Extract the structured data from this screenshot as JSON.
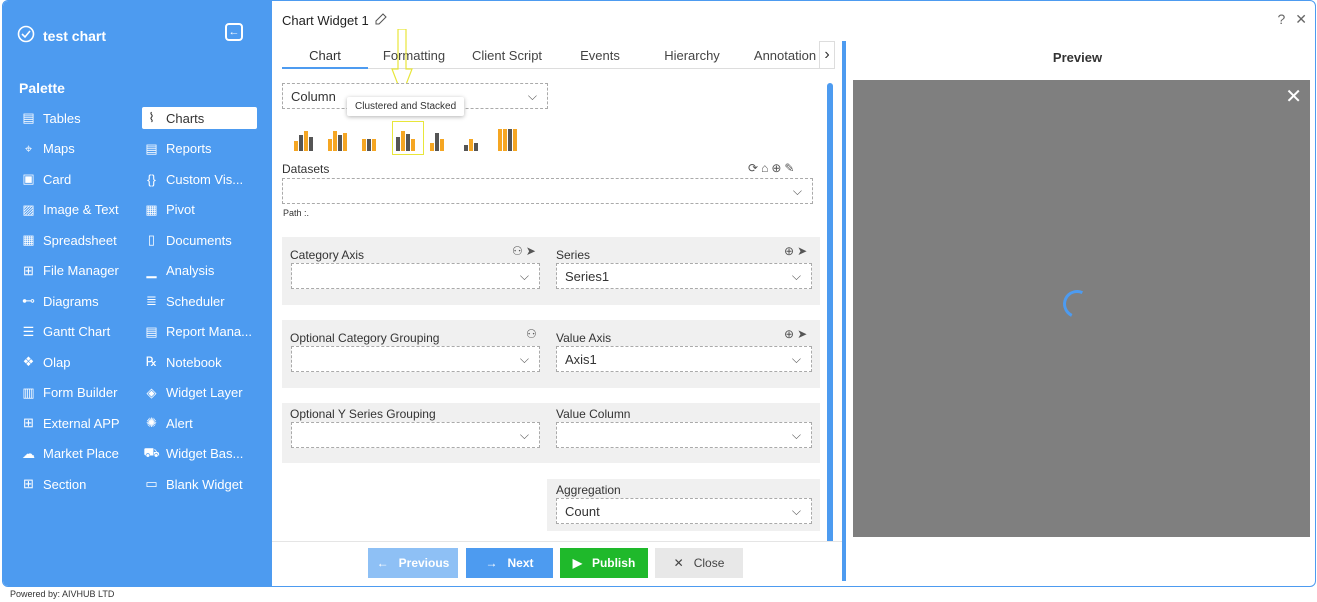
{
  "app": {
    "title": "test chart"
  },
  "palette": {
    "title": "Palette",
    "left": [
      {
        "label": "Tables",
        "icon": "table-icon"
      },
      {
        "label": "Maps",
        "icon": "map-icon"
      },
      {
        "label": "Card",
        "icon": "card-icon"
      },
      {
        "label": "Image & Text",
        "icon": "image-icon"
      },
      {
        "label": "Spreadsheet",
        "icon": "spreadsheet-icon"
      },
      {
        "label": "File Manager",
        "icon": "folder-tree-icon"
      },
      {
        "label": "Diagrams",
        "icon": "diagram-icon"
      },
      {
        "label": "Gantt Chart",
        "icon": "gantt-icon"
      },
      {
        "label": "Olap",
        "icon": "cubes-icon"
      },
      {
        "label": "Form Builder",
        "icon": "form-icon"
      },
      {
        "label": "External APP",
        "icon": "apps-icon"
      },
      {
        "label": "Market Place",
        "icon": "cloud-upload-icon"
      },
      {
        "label": "Section",
        "icon": "section-grid-icon"
      }
    ],
    "right": [
      {
        "label": "Charts",
        "icon": "line-chart-icon"
      },
      {
        "label": "Reports",
        "icon": "report-icon"
      },
      {
        "label": "Custom Vis...",
        "icon": "braces-icon"
      },
      {
        "label": "Pivot",
        "icon": "pivot-icon"
      },
      {
        "label": "Documents",
        "icon": "document-icon"
      },
      {
        "label": "Analysis",
        "icon": "analysis-icon"
      },
      {
        "label": "Scheduler",
        "icon": "scheduler-icon"
      },
      {
        "label": "Report Mana...",
        "icon": "report-manager-icon"
      },
      {
        "label": "Notebook",
        "icon": "notebook-icon"
      },
      {
        "label": "Widget Layer",
        "icon": "layers-icon"
      },
      {
        "label": "Alert",
        "icon": "alert-icon"
      },
      {
        "label": "Widget Bas...",
        "icon": "basket-icon"
      },
      {
        "label": "Blank Widget",
        "icon": "blank-widget-icon"
      }
    ]
  },
  "footer": {
    "powered": "Powered by: AIVHUB LTD"
  },
  "editor": {
    "widget_title": "Chart Widget 1",
    "tabs": [
      "Chart",
      "Formatting",
      "Client Script",
      "Events",
      "Hierarchy",
      "Annotation"
    ],
    "chart_type_value": "Column",
    "tooltip": "Clustered and Stacked",
    "datasets_label": "Datasets",
    "path_label": "Path :.",
    "category_axis_label": "Category Axis",
    "series_label": "Series",
    "series_value": "Series1",
    "opt_category_label": "Optional Category Grouping",
    "value_axis_label": "Value Axis",
    "value_axis_value": "Axis1",
    "opt_y_label": "Optional Y Series Grouping",
    "value_column_label": "Value Column",
    "aggregation_label": "Aggregation",
    "aggregation_value": "Count"
  },
  "buttons": {
    "previous": "Previous",
    "next": "Next",
    "publish": "Publish",
    "close": "Close"
  },
  "preview": {
    "title": "Preview"
  },
  "colors": {
    "accent": "#4d9bf0",
    "publish": "#1fb92b",
    "bar_orange": "#f5a623"
  }
}
